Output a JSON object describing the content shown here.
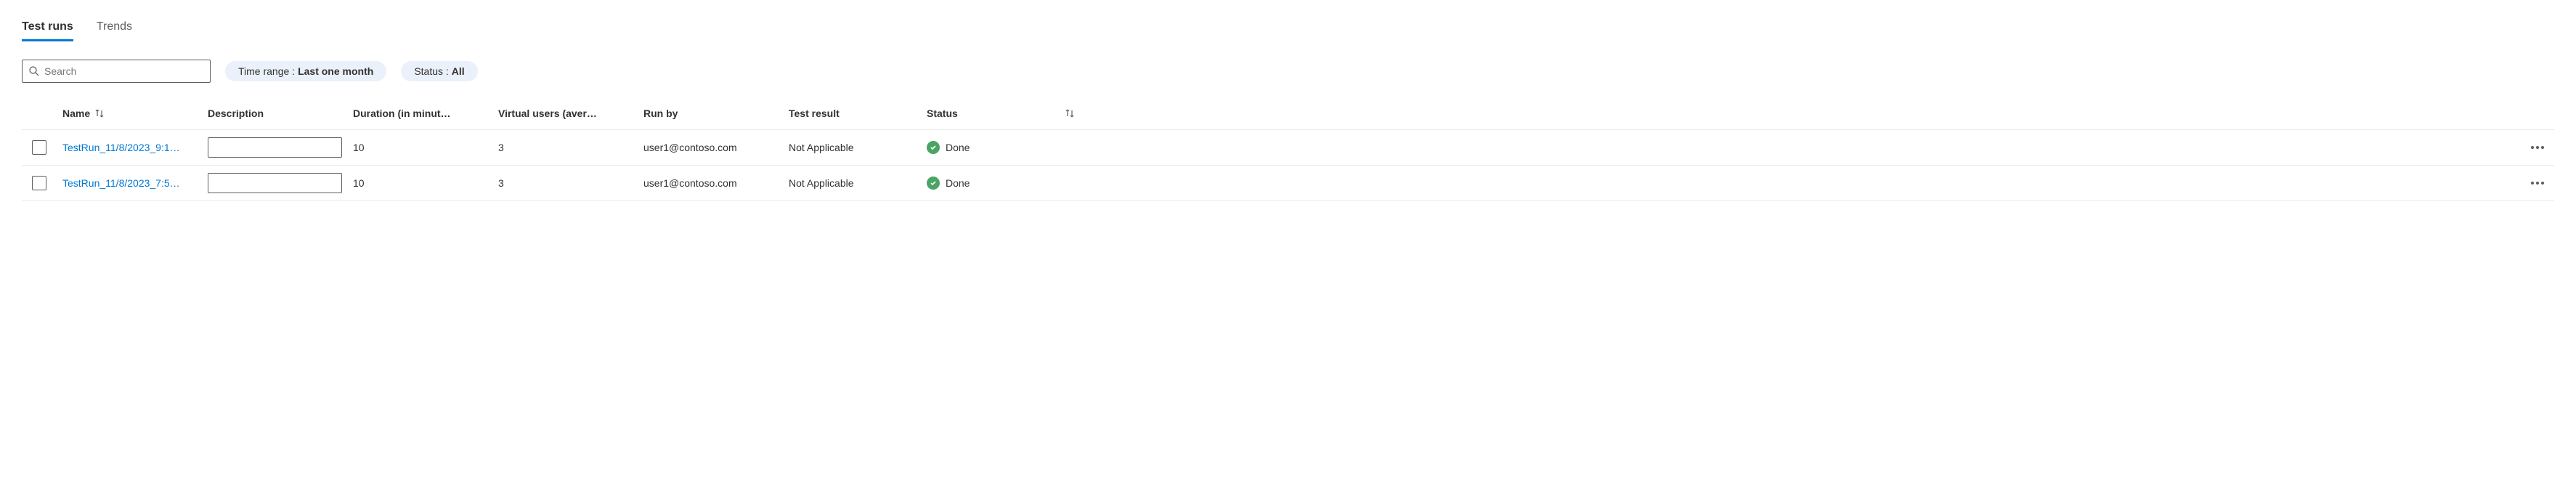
{
  "tabs": {
    "test_runs": "Test runs",
    "trends": "Trends"
  },
  "search": {
    "placeholder": "Search"
  },
  "filters": {
    "time_range": {
      "label": "Time range : ",
      "value": "Last one month"
    },
    "status": {
      "label": "Status : ",
      "value": "All"
    }
  },
  "columns": {
    "name": "Name",
    "description": "Description",
    "duration": "Duration (in minut…",
    "virtual_users": "Virtual users (aver…",
    "run_by": "Run by",
    "test_result": "Test result",
    "status": "Status"
  },
  "rows": [
    {
      "name": "TestRun_11/8/2023_9:1…",
      "description": "",
      "duration": "10",
      "virtual_users": "3",
      "run_by": "user1@contoso.com",
      "test_result": "Not Applicable",
      "status": "Done"
    },
    {
      "name": "TestRun_11/8/2023_7:5…",
      "description": "",
      "duration": "10",
      "virtual_users": "3",
      "run_by": "user1@contoso.com",
      "test_result": "Not Applicable",
      "status": "Done"
    }
  ]
}
